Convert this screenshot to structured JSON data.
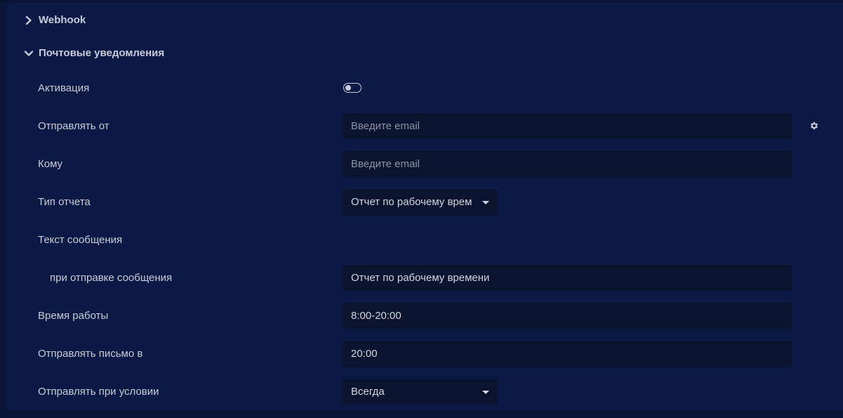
{
  "sections": {
    "webhook": {
      "label": "Webhook",
      "expanded": false,
      "icon": "chevron-right-icon"
    },
    "mail": {
      "label": "Почтовые уведомления",
      "expanded": true,
      "icon": "chevron-down-icon"
    }
  },
  "form": {
    "activation": {
      "label": "Активация",
      "enabled": false
    },
    "send_from": {
      "label": "Отправлять от",
      "value": "",
      "placeholder": "Введите email",
      "settings_icon": "gear-icon"
    },
    "to": {
      "label": "Кому",
      "value": "",
      "placeholder": "Введите email"
    },
    "report_type": {
      "label": "Тип отчета",
      "value": "Отчет по рабочему врем"
    },
    "message_text": {
      "label": "Текст сообщения"
    },
    "on_send": {
      "label": "при отправке сообщения",
      "value": "Отчет по рабочему времени"
    },
    "work_time": {
      "label": "Время работы",
      "value": "8:00-20:00"
    },
    "send_at": {
      "label": "Отправлять письмо в",
      "value": "20:00"
    },
    "send_condition": {
      "label": "Отправлять при условии",
      "value": "Всегда"
    }
  },
  "colors": {
    "background": "#0b1a45",
    "outer": "#0a1433",
    "field": "#0a142e",
    "text": "#c9ccd8"
  }
}
